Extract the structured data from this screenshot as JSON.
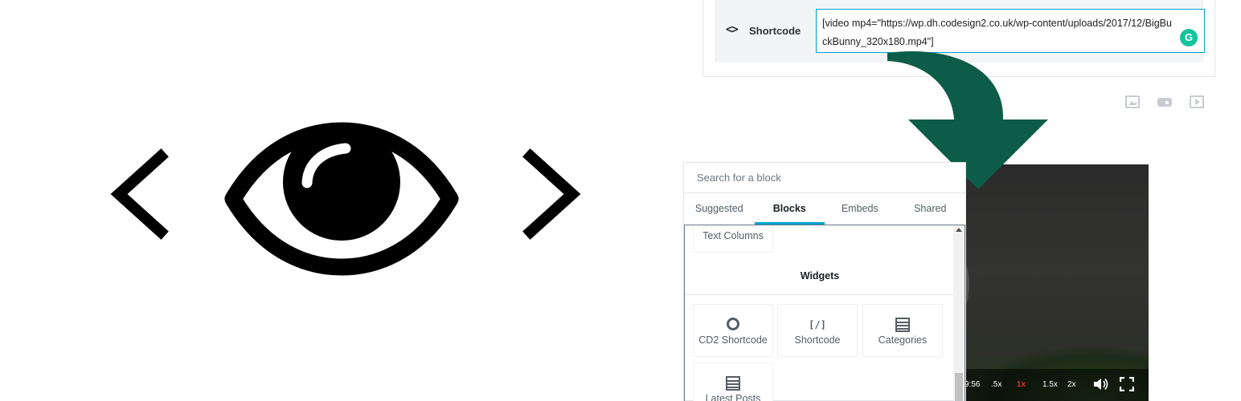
{
  "shortcode_panel": {
    "icon": "code-brackets-icon",
    "label": "Shortcode",
    "value": "[video mp4=\"https://wp.dh.codesign2.co.uk/wp-content/uploads/2017/12/BigBuckBunny_320x180.mp4\"]"
  },
  "toolbar_icons": [
    "image-icon",
    "media-icon",
    "video-icon"
  ],
  "video_controls": {
    "time": "9:56",
    "speeds": [
      ".5x",
      "1x",
      "1.5x",
      "2x"
    ],
    "active_speed": "1x"
  },
  "inserter": {
    "search_placeholder": "Search for a block",
    "tabs": [
      "Suggested",
      "Blocks",
      "Embeds",
      "Shared"
    ],
    "active_tab": "Blocks",
    "partial_block": "Text Columns",
    "section_heading": "Widgets",
    "blocks": [
      {
        "label": "CD2 Shortcode",
        "icon": "ring-icon"
      },
      {
        "label": "Shortcode",
        "icon": "shortcode-icon"
      },
      {
        "label": "Categories",
        "icon": "list-icon"
      },
      {
        "label": "Latest Posts",
        "icon": "list-icon"
      }
    ]
  },
  "logo": {
    "icon": "eye-code-logo-icon"
  },
  "colors": {
    "arrow": "#0d5c48",
    "accent": "#00a0d2",
    "grammarly": "#15c39a",
    "active_speed": "#e3301a"
  }
}
